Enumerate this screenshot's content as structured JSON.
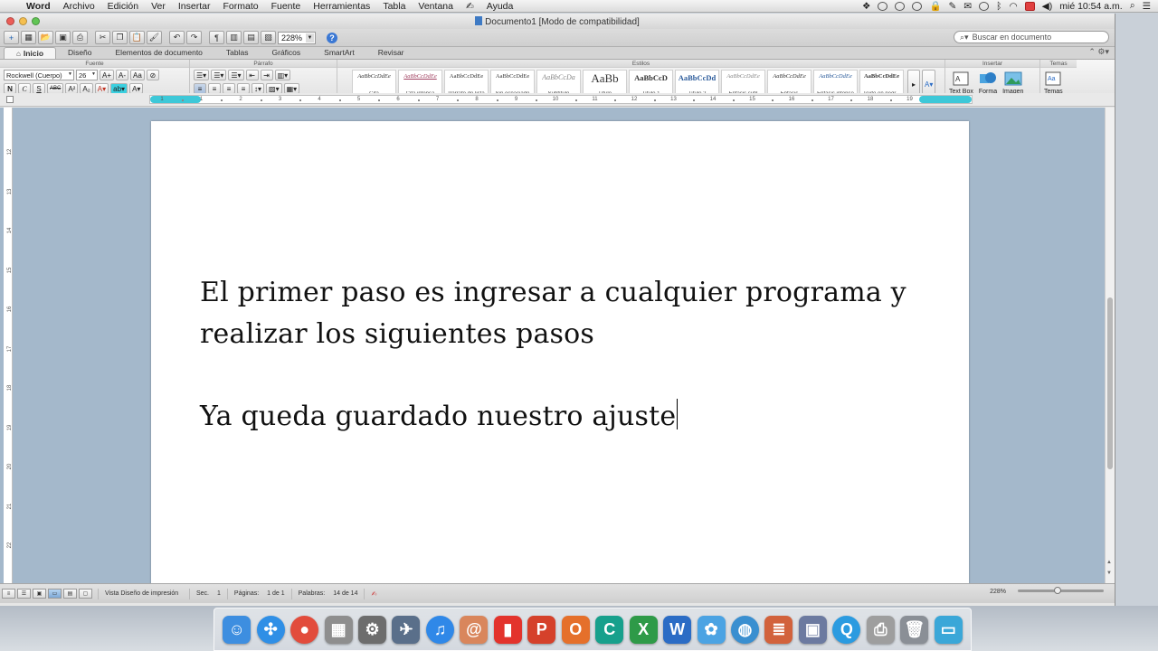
{
  "menubar": {
    "app_name": "Word",
    "items": [
      "Archivo",
      "Edición",
      "Ver",
      "Insertar",
      "Formato",
      "Fuente",
      "Herramientas",
      "Tabla",
      "Ventana"
    ],
    "help_label": "Ayuda",
    "clock": "mié 10:54 a.m."
  },
  "window": {
    "title": "Documento1 [Modo de compatibilidad]"
  },
  "toolbar": {
    "zoom_value": "228%",
    "search_placeholder": "Buscar en documento"
  },
  "ribbon": {
    "tabs": [
      "Inicio",
      "Diseño",
      "Elementos de documento",
      "Tablas",
      "Gráficos",
      "SmartArt",
      "Revisar"
    ],
    "group_titles": {
      "font": "Fuente",
      "paragraph": "Párrafo",
      "styles": "Estilos",
      "insert": "Insertar",
      "themes": "Temas"
    },
    "font_name": "Rockwell (Cuerpo)",
    "font_size": "26",
    "format_buttons": [
      "N",
      "C",
      "S",
      "ABC"
    ],
    "styles": [
      {
        "sample": "AaBbCcDdEe",
        "name": "Cita"
      },
      {
        "sample": "AaBbCcDdEe",
        "name": "Cita intensa"
      },
      {
        "sample": "AaBbCcDdEe",
        "name": "Párrafo de lista"
      },
      {
        "sample": "AaBbCcDdEe",
        "name": "Sin espaciado"
      },
      {
        "sample": "AaBbCcDa",
        "name": "Subtítulo"
      },
      {
        "sample": "AaBb",
        "name": "Título"
      },
      {
        "sample": "AaBbCcD",
        "name": "Título 1"
      },
      {
        "sample": "AaBbCcDd",
        "name": "Título 2"
      },
      {
        "sample": "AaBbCcDdEe",
        "name": "Énfasis sutil"
      },
      {
        "sample": "AaBbCcDdEe",
        "name": "Énfasis"
      },
      {
        "sample": "AaBbCcDdEe",
        "name": "Énfasis intenso"
      },
      {
        "sample": "AaBbCcDdEe",
        "name": "Texto en negr..."
      }
    ],
    "insert_buttons": [
      "Text Box",
      "Forma",
      "Imagen"
    ],
    "themes_button": "Temas"
  },
  "ruler": {
    "ticks": [
      "1",
      "1",
      "2",
      "3",
      "4",
      "5",
      "6",
      "7",
      "8",
      "9",
      "10",
      "11",
      "12",
      "13",
      "14",
      "15",
      "16",
      "17",
      "18",
      "19"
    ]
  },
  "vertical_ruler": {
    "ticks": [
      "12",
      "13",
      "14",
      "15",
      "16",
      "17",
      "18",
      "19",
      "20",
      "21",
      "22"
    ]
  },
  "document": {
    "paragraph_1": "El primer paso es ingresar a cualquier programa y realizar los siguientes pasos",
    "paragraph_2": "Ya queda guardado nuestro ajuste"
  },
  "statusbar": {
    "view_name": "Vista Diseño de impresión",
    "section_label": "Sec.",
    "section_value": "1",
    "pages_label": "Páginas:",
    "pages_value": "1 de 1",
    "words_label": "Palabras:",
    "words_value": "14 de 14",
    "zoom": "228%"
  },
  "dock": {
    "apps": [
      {
        "icon": "finder-icon",
        "glyph": "☺",
        "color": "#3d8ee0"
      },
      {
        "icon": "safari-icon",
        "glyph": "✣",
        "color": "#2f8fe6"
      },
      {
        "icon": "chrome-icon",
        "glyph": "●",
        "color": "#e24c3c"
      },
      {
        "icon": "calculator-icon",
        "glyph": "▦",
        "color": "#8e8e8e"
      },
      {
        "icon": "system-preferences-icon",
        "glyph": "⚙",
        "color": "#6d6d6d"
      },
      {
        "icon": "launchpad-icon",
        "glyph": "✈",
        "color": "#5a6f8a"
      },
      {
        "icon": "itunes-icon",
        "glyph": "♫",
        "color": "#2f88e8"
      },
      {
        "icon": "address-book-icon",
        "glyph": "@",
        "color": "#d9865c"
      },
      {
        "icon": "ibooks-icon",
        "glyph": "▮",
        "color": "#e3332c"
      },
      {
        "icon": "powerpoint-icon",
        "glyph": "P",
        "color": "#d5412b"
      },
      {
        "icon": "office-icon",
        "glyph": "O",
        "color": "#e5702b"
      },
      {
        "icon": "c-app-icon",
        "glyph": "C",
        "color": "#17a08c"
      },
      {
        "icon": "excel-icon",
        "glyph": "X",
        "color": "#2e9a48"
      },
      {
        "icon": "word-icon",
        "glyph": "W",
        "color": "#2b6cc5"
      },
      {
        "icon": "messenger-icon",
        "glyph": "✿",
        "color": "#4ba3e3"
      },
      {
        "icon": "earth-icon",
        "glyph": "◍",
        "color": "#3a8fd0"
      },
      {
        "icon": "notes-icon",
        "glyph": "≣",
        "color": "#d2623c"
      },
      {
        "icon": "photos-icon",
        "glyph": "▣",
        "color": "#6c7aa0"
      },
      {
        "icon": "quicktime-icon",
        "glyph": "Q",
        "color": "#2b9be0"
      },
      {
        "icon": "printer-icon",
        "glyph": "⎙",
        "color": "#9e9e9e"
      },
      {
        "icon": "trash-icon",
        "glyph": "🗑",
        "color": "#8a8f96"
      },
      {
        "icon": "folder-icon",
        "glyph": "▭",
        "color": "#3aa7d8"
      }
    ]
  }
}
